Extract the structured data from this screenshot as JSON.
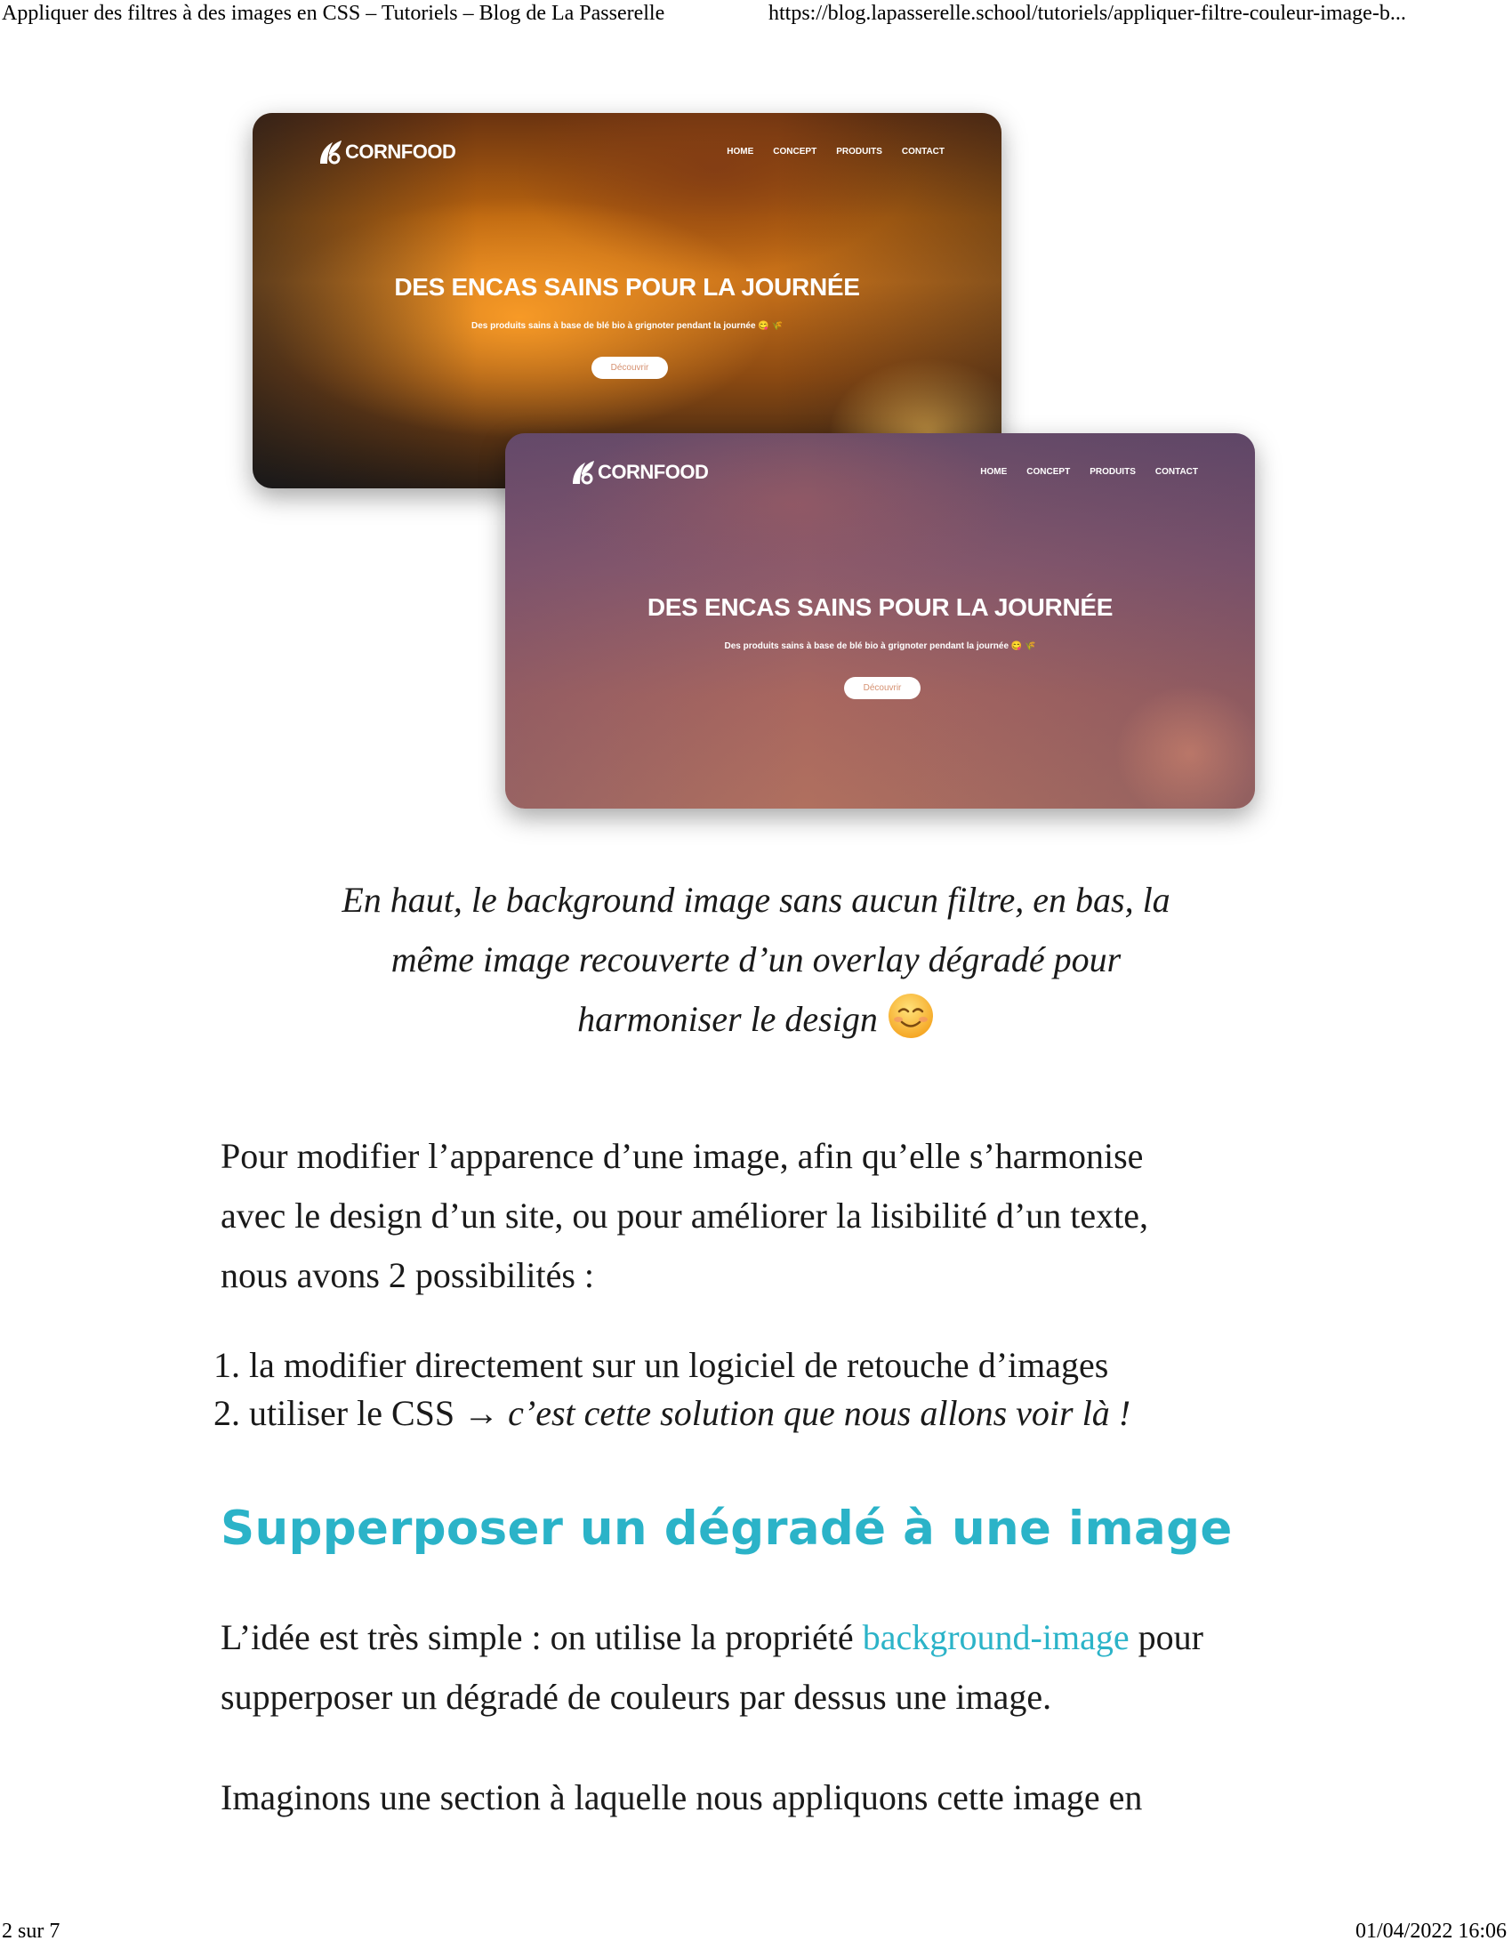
{
  "print_header": {
    "title": "Appliquer des filtres à des images en CSS – Tutoriels – Blog de La Passerelle",
    "url": "https://blog.lapasserelle.school/tutoriels/appliquer-filtre-couleur-image-b..."
  },
  "screenshots": {
    "original": {
      "logo": "CORNFOOD",
      "nav": [
        "HOME",
        "CONCEPT",
        "PRODUITS",
        "CONTACT"
      ],
      "hero_title": "DES ENCAS SAINS POUR LA JOURNÉE",
      "hero_subtitle": "Des produits sains à base de blé bio à grignoter pendant la journée 😋 🌾",
      "button": "Découvrir"
    },
    "with_overlay": {
      "logo": "CORNFOOD",
      "nav": [
        "HOME",
        "CONCEPT",
        "PRODUITS",
        "CONTACT"
      ],
      "hero_title": "DES ENCAS SAINS POUR LA JOURNÉE",
      "hero_subtitle": "Des produits sains à base de blé bio à grignoter pendant la journée 😋 🌾",
      "button": "Découvrir"
    }
  },
  "caption": {
    "line1": "En haut, le background image sans aucun filtre, en bas, la",
    "line2": "même image recouverte d’un overlay dégradé pour",
    "line3": "harmoniser le design",
    "emoji": "smiling-face-emoji"
  },
  "intro": {
    "line1": "Pour modifier l’apparence d’une image, afin qu’elle s’harmonise",
    "line2": "avec le design d’un site, ou pour améliorer la lisibilité d’un texte,",
    "line3": "nous avons 2 possibilités :"
  },
  "options": [
    {
      "num": "1.",
      "text": "la modifier directement sur un logiciel de retouche d’images",
      "emphasis": ""
    },
    {
      "num": "2.",
      "text": "utiliser le CSS → ",
      "emphasis": "c’est cette solution que nous allons voir là !"
    }
  ],
  "section_heading": "Supperposer un dégradé à une image",
  "section_para": {
    "before_link": "L’idée est très simple : on utilise la propriété ",
    "link": "background-image",
    "after_link": " pour",
    "line2": "supperposer un dégradé de couleurs par dessus une image."
  },
  "next_para": "Imaginons une section à laquelle nous appliquons cette image en",
  "print_footer": {
    "page": "2 sur 7",
    "date": "01/04/2022 16:06"
  },
  "colors": {
    "heading": "#2bb3c8",
    "link": "#2bb3c8",
    "text": "#1a1a1a"
  }
}
